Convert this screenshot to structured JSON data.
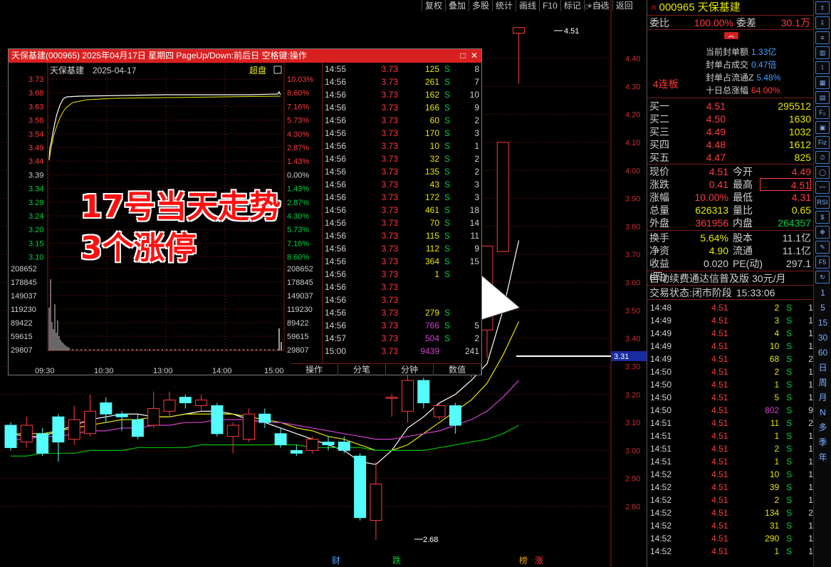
{
  "toolbar": [
    "复权",
    "叠加",
    "多股",
    "统计",
    "画线",
    "F10",
    "标记",
    "+自选",
    "返回"
  ],
  "main_chart": {
    "price_ticks": [
      "4.40",
      "4.30",
      "4.20",
      "4.10",
      "4.00",
      "3.90",
      "3.80",
      "3.70",
      "3.60",
      "3.50",
      "3.40",
      "3.30",
      "3.20",
      "3.10",
      "3.00",
      "2.90",
      "2.80"
    ],
    "current_price_tag": "3.31",
    "high_label": "4.51",
    "low_label": "2.68",
    "colors": {
      "up": "#ff3b3b",
      "down": "#54fcfc",
      "ma5": "#ffffff",
      "ma10": "#e6e600",
      "ma20": "#d040d0",
      "ma60": "#00c000"
    },
    "candles": [
      {
        "o": 3.09,
        "c": 3.01,
        "h": 3.1,
        "l": 3.0
      },
      {
        "o": 3.03,
        "c": 3.09,
        "h": 3.12,
        "l": 3.01
      },
      {
        "o": 3.06,
        "c": 2.99,
        "h": 3.08,
        "l": 2.98
      },
      {
        "o": 3.12,
        "c": 3.03,
        "h": 3.13,
        "l": 2.96
      },
      {
        "o": 3.04,
        "c": 3.11,
        "h": 3.16,
        "l": 3.02
      },
      {
        "o": 3.06,
        "c": 3.14,
        "h": 3.2,
        "l": 3.05
      },
      {
        "o": 3.17,
        "c": 3.13,
        "h": 3.19,
        "l": 3.1
      },
      {
        "o": 3.13,
        "c": 3.12,
        "h": 3.14,
        "l": 3.07
      },
      {
        "o": 3.11,
        "c": 3.05,
        "h": 3.13,
        "l": 3.04
      },
      {
        "o": 3.09,
        "c": 3.15,
        "h": 3.21,
        "l": 3.08
      },
      {
        "o": 3.14,
        "c": 3.18,
        "h": 3.21,
        "l": 3.12
      },
      {
        "o": 3.19,
        "c": 3.17,
        "h": 3.2,
        "l": 3.15
      },
      {
        "o": 3.16,
        "c": 3.18,
        "h": 3.2,
        "l": 3.14
      },
      {
        "o": 3.16,
        "c": 3.06,
        "h": 3.17,
        "l": 3.05
      },
      {
        "o": 3.05,
        "c": 3.09,
        "h": 3.1,
        "l": 2.99
      },
      {
        "o": 3.04,
        "c": 3.13,
        "h": 3.15,
        "l": 3.03
      },
      {
        "o": 3.13,
        "c": 3.1,
        "h": 3.15,
        "l": 3.08
      },
      {
        "o": 3.06,
        "c": 3.02,
        "h": 3.08,
        "l": 3.01
      },
      {
        "o": 3.0,
        "c": 2.99,
        "h": 3.02,
        "l": 2.98
      },
      {
        "o": 3.0,
        "c": 3.04,
        "h": 3.05,
        "l": 2.99
      },
      {
        "o": 3.03,
        "c": 3.02,
        "h": 3.05,
        "l": 3.0
      },
      {
        "o": 3.03,
        "c": 3.0,
        "h": 3.05,
        "l": 2.99
      },
      {
        "o": 2.98,
        "c": 2.76,
        "h": 2.99,
        "l": 2.75
      },
      {
        "o": 2.75,
        "c": 2.88,
        "h": 2.96,
        "l": 2.68
      },
      {
        "o": 3.19,
        "c": 3.19,
        "h": 3.2,
        "l": 3.12
      },
      {
        "o": 3.14,
        "c": 3.25,
        "h": 3.34,
        "l": 3.1
      },
      {
        "o": 3.25,
        "c": 3.17,
        "h": 3.26,
        "l": 3.15
      },
      {
        "o": 3.12,
        "c": 3.16,
        "h": 3.17,
        "l": 3.11
      },
      {
        "o": 3.16,
        "c": 3.09,
        "h": 3.17,
        "l": 3.06
      },
      {
        "o": 3.27,
        "c": 3.39,
        "h": 3.4,
        "l": 3.26
      },
      {
        "o": 3.43,
        "c": 3.73,
        "h": 3.73,
        "l": 3.33
      },
      {
        "o": 3.71,
        "c": 4.1,
        "h": 4.1,
        "l": 3.72
      },
      {
        "o": 4.49,
        "c": 4.51,
        "h": 4.51,
        "l": 4.31
      }
    ],
    "ma5": [
      3.06,
      3.05,
      3.05,
      3.07,
      3.09,
      3.11,
      3.12,
      3.13,
      3.13,
      3.12,
      3.12,
      3.13,
      3.14,
      3.14,
      3.13,
      3.11,
      3.1,
      3.08,
      3.06,
      3.04,
      3.02,
      3.0,
      2.96,
      2.95,
      3.0,
      3.08,
      3.12,
      3.17,
      3.2,
      3.25,
      3.31,
      3.5,
      3.75
    ],
    "ma10": [
      3.06,
      3.06,
      3.06,
      3.07,
      3.08,
      3.09,
      3.1,
      3.11,
      3.11,
      3.12,
      3.12,
      3.13,
      3.13,
      3.13,
      3.13,
      3.12,
      3.11,
      3.1,
      3.08,
      3.07,
      3.05,
      3.04,
      3.02,
      3.0,
      3.0,
      3.02,
      3.06,
      3.1,
      3.14,
      3.18,
      3.24,
      3.34,
      3.46
    ],
    "ma20": [
      3.04,
      3.04,
      3.05,
      3.05,
      3.06,
      3.07,
      3.07,
      3.08,
      3.08,
      3.09,
      3.09,
      3.1,
      3.1,
      3.11,
      3.11,
      3.11,
      3.1,
      3.1,
      3.09,
      3.08,
      3.07,
      3.06,
      3.05,
      3.04,
      3.04,
      3.05,
      3.06,
      3.07,
      3.09,
      3.11,
      3.14,
      3.19,
      3.25
    ],
    "ma60": [
      2.98,
      2.98,
      2.99,
      2.99,
      2.99,
      3.0,
      3.0,
      3.0,
      3.01,
      3.01,
      3.01,
      3.01,
      3.02,
      3.02,
      3.02,
      3.02,
      3.02,
      3.02,
      3.02,
      3.01,
      3.01,
      3.01,
      3.01,
      3.0,
      3.0,
      3.0,
      3.0,
      3.01,
      3.02,
      3.03,
      3.04,
      3.06,
      3.09
    ]
  },
  "popup": {
    "title": "天保基建(000965) 2025年04月17日 星期四 PageUp/Down:前后日 空格键:操作",
    "chart_name": "天保基建",
    "chart_date": "2025-04-17",
    "chart_mode": "超盘",
    "left_ticks": [
      "3.73",
      "3.68",
      "3.63",
      "3.58",
      "3.54",
      "3.49",
      "3.44",
      "3.39",
      "3.34",
      "3.29",
      "3.24",
      "3.20",
      "3.15",
      "3.10"
    ],
    "right_ticks": [
      "10.03%",
      "8.60%",
      "7.16%",
      "5.73%",
      "4.30%",
      "2.87%",
      "1.43%",
      "0.00%",
      "1.43%",
      "2.87%",
      "4.30%",
      "5.73%",
      "7.16%",
      "8.60%"
    ],
    "vol_ticks": [
      "208652",
      "178845",
      "149037",
      "119230",
      "89422",
      "59615",
      "29807"
    ],
    "time_ticks": [
      "09:30",
      "10:30",
      "13:00",
      "14:00",
      "15:00"
    ],
    "ticks": [
      {
        "t": "14:55",
        "p": "3.73",
        "v": "125",
        "s": "S",
        "n": "8"
      },
      {
        "t": "14:56",
        "p": "3.73",
        "v": "261",
        "s": "S",
        "n": "7"
      },
      {
        "t": "14:56",
        "p": "3.73",
        "v": "162",
        "s": "S",
        "n": "10"
      },
      {
        "t": "14:56",
        "p": "3.73",
        "v": "166",
        "s": "S",
        "n": "9"
      },
      {
        "t": "14:56",
        "p": "3.73",
        "v": "60",
        "s": "S",
        "n": "2"
      },
      {
        "t": "14:56",
        "p": "3.73",
        "v": "170",
        "s": "S",
        "n": "3"
      },
      {
        "t": "14:56",
        "p": "3.73",
        "v": "10",
        "s": "S",
        "n": "1"
      },
      {
        "t": "14:56",
        "p": "3.73",
        "v": "32",
        "s": "S",
        "n": "2"
      },
      {
        "t": "14:56",
        "p": "3.73",
        "v": "135",
        "s": "S",
        "n": "2"
      },
      {
        "t": "14:56",
        "p": "3.73",
        "v": "43",
        "s": "S",
        "n": "3"
      },
      {
        "t": "14:56",
        "p": "3.73",
        "v": "172",
        "s": "S",
        "n": "3"
      },
      {
        "t": "14:56",
        "p": "3.73",
        "v": "461",
        "s": "S",
        "n": "18"
      },
      {
        "t": "14:56",
        "p": "3.73",
        "v": "70",
        "s": "S",
        "n": "14"
      },
      {
        "t": "14:56",
        "p": "3.73",
        "v": "115",
        "s": "S",
        "n": "11"
      },
      {
        "t": "14:56",
        "p": "3.73",
        "v": "112",
        "s": "S",
        "n": "9"
      },
      {
        "t": "14:56",
        "p": "3.73",
        "v": "364",
        "s": "S",
        "n": "15"
      },
      {
        "t": "14:56",
        "p": "3.73",
        "v": "1",
        "s": "S",
        "n": ""
      },
      {
        "t": "14:56",
        "p": "3.73",
        "v": "",
        "s": "",
        "n": ""
      },
      {
        "t": "14:56",
        "p": "3.73",
        "v": "",
        "s": "",
        "n": ""
      },
      {
        "t": "14:56",
        "p": "3.73",
        "v": "279",
        "s": "S",
        "n": ""
      },
      {
        "t": "14:56",
        "p": "3.73",
        "v": "766",
        "s": "S",
        "n": "5"
      },
      {
        "t": "14:57",
        "p": "3.73",
        "v": "504",
        "s": "S",
        "n": "2"
      },
      {
        "t": "15:00",
        "p": "3.73",
        "v": "9439",
        "s": "",
        "n": "241"
      }
    ],
    "tabs": [
      "操作",
      "分笔",
      "分钟",
      "数值"
    ]
  },
  "annotation": {
    "line1": "17号当天走势",
    "line2": "3个涨停"
  },
  "right_panel": {
    "code_name": "000965 天保基建",
    "r_mark": "R",
    "weibi_label": "委比",
    "weibi": "100.00%",
    "weicha_label": "委差",
    "weicha": "30.1万",
    "lianban": "4连板",
    "seal": [
      {
        "label": "当前封单额",
        "value": "1.33亿"
      },
      {
        "label": "封单占成交",
        "value": "0.47倍"
      },
      {
        "label": "封单占流通Z",
        "value": "5.48%"
      },
      {
        "label": "十日总涨幅",
        "value": "64.00%"
      }
    ],
    "bids": [
      {
        "label": "买一",
        "price": "4.51",
        "vol": "295512"
      },
      {
        "label": "买二",
        "price": "4.50",
        "vol": "1630"
      },
      {
        "label": "买三",
        "price": "4.49",
        "vol": "1032"
      },
      {
        "label": "买四",
        "price": "4.48",
        "vol": "1612"
      },
      {
        "label": "买五",
        "price": "4.47",
        "vol": "825"
      }
    ],
    "quote": [
      {
        "k1": "现价",
        "v1": "4.51",
        "k2": "今开",
        "v2": "4.49"
      },
      {
        "k1": "涨跌",
        "v1": "0.41",
        "k2": "最高",
        "v2": "4.51"
      },
      {
        "k1": "涨幅",
        "v1": "10.00%",
        "k2": "最低",
        "v2": "4.31"
      },
      {
        "k1": "总量",
        "v1": "626313",
        "k2": "量比",
        "v2": "0.65"
      },
      {
        "k1": "外盘",
        "v1": "361956",
        "k2": "内盘",
        "v2": "264357"
      }
    ],
    "quote2": [
      {
        "k1": "换手",
        "v1": "5.64%",
        "k2": "股本",
        "v2": "11.1亿"
      },
      {
        "k1": "净资",
        "v1": "4.90",
        "k2": "流通",
        "v2": "11.1亿"
      },
      {
        "k1": "收益(四)",
        "v1": "0.020",
        "k2": "PE(动)",
        "v2": "297.1"
      }
    ],
    "promo": "自动续费通达信普及版",
    "promo_price": "30元/月",
    "status_label": "交易状态:",
    "status": "闭市阶段",
    "status_time": "15:33:06",
    "ticks": [
      {
        "t": "14:48",
        "p": "4.51",
        "v": "2",
        "s": "S",
        "n": "1"
      },
      {
        "t": "14:49",
        "p": "4.51",
        "v": "3",
        "s": "S",
        "n": "1"
      },
      {
        "t": "14:49",
        "p": "4.51",
        "v": "4",
        "s": "S",
        "n": "1"
      },
      {
        "t": "14:49",
        "p": "4.51",
        "v": "10",
        "s": "S",
        "n": "1"
      },
      {
        "t": "14:49",
        "p": "4.51",
        "v": "68",
        "s": "S",
        "n": "2"
      },
      {
        "t": "14:50",
        "p": "4.51",
        "v": "2",
        "s": "S",
        "n": "1"
      },
      {
        "t": "14:50",
        "p": "4.51",
        "v": "1",
        "s": "S",
        "n": "1"
      },
      {
        "t": "14:50",
        "p": "4.51",
        "v": "5",
        "s": "S",
        "n": "1"
      },
      {
        "t": "14:50",
        "p": "4.51",
        "v": "802",
        "s": "S",
        "n": "9"
      },
      {
        "t": "14:51",
        "p": "4.51",
        "v": "11",
        "s": "S",
        "n": "2"
      },
      {
        "t": "14:51",
        "p": "4.51",
        "v": "1",
        "s": "S",
        "n": "1"
      },
      {
        "t": "14:51",
        "p": "4.51",
        "v": "2",
        "s": "S",
        "n": "1"
      },
      {
        "t": "14:51",
        "p": "4.51",
        "v": "1",
        "s": "S",
        "n": "1"
      },
      {
        "t": "14:52",
        "p": "4.51",
        "v": "10",
        "s": "S",
        "n": "1"
      },
      {
        "t": "14:52",
        "p": "4.51",
        "v": "39",
        "s": "S",
        "n": "1"
      },
      {
        "t": "14:52",
        "p": "4.51",
        "v": "2",
        "s": "S",
        "n": "1"
      },
      {
        "t": "14:52",
        "p": "4.51",
        "v": "134",
        "s": "S",
        "n": "2"
      },
      {
        "t": "14:52",
        "p": "4.51",
        "v": "31",
        "s": "S",
        "n": "1"
      },
      {
        "t": "14:52",
        "p": "4.51",
        "v": "290",
        "s": "S",
        "n": "1"
      },
      {
        "t": "14:52",
        "p": "4.51",
        "v": "1",
        "s": "S",
        "n": "1"
      }
    ]
  },
  "icon_strip": {
    "icons": [
      "arrow-up-icon",
      "arrow-down-icon",
      "list-icon",
      "bar-chart-icon",
      "line-chart-icon",
      "grid-icon",
      "document-icon",
      "f10-icon",
      "calendar-icon",
      "fiz-icon",
      "clock-icon",
      "circle-icon",
      "wave-icon",
      "rsi-icon",
      "dollar-icon",
      "move-icon",
      "pencil-icon",
      "f5-icon",
      "refresh-icon"
    ],
    "icon_text": [
      "⇧",
      "⇩",
      "≡",
      "▥",
      "⌇",
      "▦",
      "▤",
      "F₀",
      "▣",
      "Fiz",
      "⏱",
      "◯",
      "〰",
      "RSI",
      "$",
      "✥",
      "✎",
      "F5",
      "↻"
    ],
    "periods": [
      "1",
      "5",
      "15",
      "30",
      "60",
      "日",
      "周",
      "月",
      "N",
      "多",
      "季",
      "年"
    ]
  },
  "bottom_markers": [
    {
      "text": "财",
      "color": "#4aa0ff"
    },
    {
      "text": "跌",
      "color": "#00d040"
    },
    {
      "text": "榜",
      "color": "#e6a000"
    },
    {
      "text": "涨",
      "color": "#ff3b3b"
    }
  ]
}
